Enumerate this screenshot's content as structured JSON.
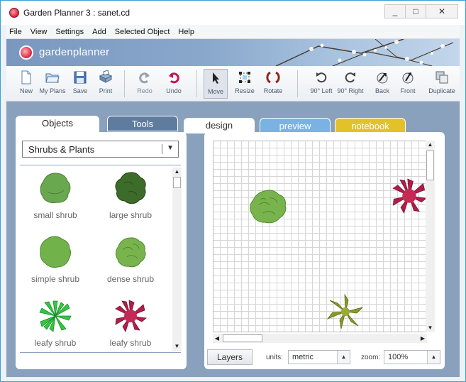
{
  "window": {
    "title": "Garden Planner 3 : sanet.cd",
    "minimize": "_",
    "maximize": "□",
    "close": "✕"
  },
  "menu": {
    "items": [
      "File",
      "View",
      "Settings",
      "Add",
      "Selected Object",
      "Help"
    ]
  },
  "banner": {
    "brand": "gardenplanner"
  },
  "toolbar": {
    "new": "New",
    "my_plans": "My Plans",
    "save": "Save",
    "print": "Print",
    "redo": "Redo",
    "undo": "Undo",
    "move": "Move",
    "resize": "Resize",
    "rotate": "Rotate",
    "rotate_left": "90° Left",
    "rotate_right": "90° Right",
    "back": "Back",
    "front": "Front",
    "duplicate": "Duplicate"
  },
  "left_panel": {
    "tabs": [
      "Objects",
      "Tools"
    ],
    "category": "Shrubs & Plants",
    "objects": [
      {
        "label": "small shrub",
        "color": "#6aa84f"
      },
      {
        "label": "large shrub",
        "color": "#3d6b2a"
      },
      {
        "label": "simple shrub",
        "color": "#72b24a"
      },
      {
        "label": "dense shrub",
        "color": "#79b34d"
      },
      {
        "label": "leafy shrub",
        "color": "#33c840"
      },
      {
        "label": "leafy shrub",
        "color": "#b01f4a"
      }
    ]
  },
  "design": {
    "tabs": [
      "design",
      "preview",
      "notebook"
    ],
    "layers_button": "Layers",
    "units_label": "units:",
    "units_value": "metric",
    "zoom_label": "zoom:",
    "zoom_value": "100%",
    "canvas_items": [
      "dense shrub",
      "leafy shrub (red)",
      "star plant"
    ]
  },
  "colors": {
    "accent": "#5f7c9f",
    "preview_tab": "#7ab3e3",
    "notebook_tab": "#e3c12b",
    "workarea": "#8aa1bd"
  }
}
